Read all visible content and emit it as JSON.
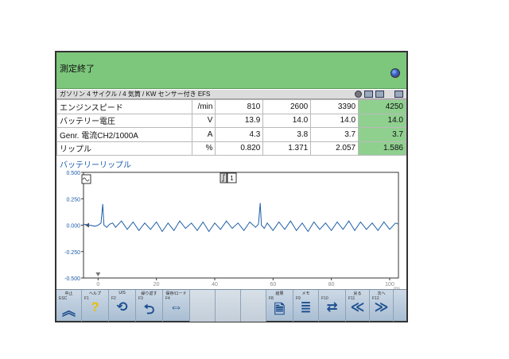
{
  "window": {
    "title": "測定終了",
    "subheader": "ガソリン 4 サイクル /  4 気筒 / KW センサー付き EFS"
  },
  "table": {
    "rows": [
      {
        "name": "エンジンスピード",
        "unit": "/min",
        "values": [
          "810",
          "2600",
          "3390",
          "4250"
        ]
      },
      {
        "name": "バッテリー電圧",
        "unit": "V",
        "values": [
          "13.9",
          "14.0",
          "14.0",
          "14.0"
        ]
      },
      {
        "name": "Genr. 電流CH2/1000A",
        "unit": "A",
        "values": [
          "4.3",
          "3.8",
          "3.7",
          "3.7"
        ]
      },
      {
        "name": "リップル",
        "unit": "%",
        "values": [
          "0.820",
          "1.371",
          "2.057",
          "1.586"
        ]
      }
    ]
  },
  "chart": {
    "title": "バッテリーリップル",
    "y_ticks": [
      "0.500",
      "0.250",
      "0.000",
      "-0.250",
      "-0.500"
    ],
    "x_ticks": [
      "0",
      "20",
      "40",
      "60",
      "80",
      "100"
    ],
    "x_unit": "ms",
    "trigger_channel": "1",
    "trace_color": "#1f5fa8"
  },
  "chart_data": {
    "type": "line",
    "title": "バッテリーリップル",
    "xlabel": "ms",
    "ylabel": "",
    "xlim": [
      -5,
      103
    ],
    "ylim": [
      -0.5,
      0.5
    ],
    "grid": false,
    "series": [
      {
        "x": [
          -5,
          -3,
          -1,
          0,
          1,
          1.6,
          2,
          3,
          4,
          5,
          6,
          8,
          10,
          12,
          14,
          16,
          18,
          20,
          22,
          24,
          26,
          28,
          30,
          32,
          34,
          36,
          38,
          40,
          42,
          44,
          46,
          48,
          50,
          52,
          54,
          55,
          55.6,
          56,
          57,
          58,
          60,
          62,
          64,
          66,
          68,
          70,
          72,
          74,
          76,
          78,
          80,
          82,
          84,
          86,
          88,
          90,
          92,
          94,
          96,
          98,
          100,
          102,
          103
        ],
        "y": [
          0.01,
          0.0,
          -0.01,
          0.0,
          0.02,
          0.2,
          0.0,
          -0.02,
          0.01,
          0.02,
          -0.02,
          0.04,
          -0.04,
          0.03,
          -0.05,
          0.02,
          -0.04,
          0.03,
          -0.06,
          0.02,
          -0.05,
          0.04,
          -0.03,
          0.02,
          -0.05,
          0.03,
          -0.06,
          0.02,
          -0.04,
          0.04,
          -0.03,
          0.02,
          -0.05,
          0.03,
          -0.02,
          0.01,
          0.21,
          0.0,
          -0.03,
          0.02,
          -0.05,
          0.03,
          -0.04,
          0.04,
          -0.05,
          0.02,
          -0.06,
          0.03,
          -0.04,
          0.02,
          -0.05,
          0.03,
          -0.04,
          0.04,
          -0.05,
          0.03,
          -0.04,
          0.02,
          -0.05,
          0.03,
          -0.04,
          0.02,
          0.01
        ]
      }
    ]
  },
  "fkeys": [
    {
      "label": "中止",
      "fn": "ESC",
      "sym": "︽"
    },
    {
      "label": "ヘルプ",
      "fn": "F1",
      "sym": "?"
    },
    {
      "label": "U/S",
      "fn": "F2",
      "sym": "⟲"
    },
    {
      "label": "繰り返す",
      "fn": "F3",
      "sym": "⮌"
    },
    {
      "label": "保存/ロード",
      "fn": "F4",
      "sym": "⇔"
    },
    {
      "label": "",
      "fn": "",
      "sym": ""
    },
    {
      "label": "",
      "fn": "",
      "sym": ""
    },
    {
      "label": "",
      "fn": "",
      "sym": ""
    },
    {
      "label": "結果",
      "fn": "F8",
      "sym": "🗎"
    },
    {
      "label": "メモ",
      "fn": "F9",
      "sym": "≣"
    },
    {
      "label": "",
      "fn": "F10",
      "sym": "⇄"
    },
    {
      "label": "戻る",
      "fn": "F11",
      "sym": "≪"
    },
    {
      "label": "次へ",
      "fn": "F12",
      "sym": "≫"
    }
  ]
}
